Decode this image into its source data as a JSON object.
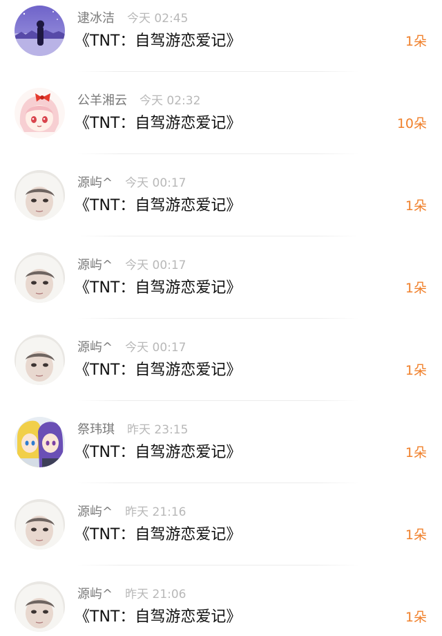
{
  "gift_list": {
    "items": [
      {
        "user_name": "逮冰洁",
        "time": "今天 02:45",
        "title": "《TNT：自驾游恋爱记》",
        "count": "1朵",
        "avatar_icon": "avatar-night-scene"
      },
      {
        "user_name": "公羊湘云",
        "time": "今天 02:32",
        "title": "《TNT：自驾游恋爱记》",
        "count": "10朵",
        "avatar_icon": "avatar-anime-girl-red-bow"
      },
      {
        "user_name": "源屿^",
        "time": "今天 00:17",
        "title": "《TNT：自驾游恋爱记》",
        "count": "1朵",
        "avatar_icon": "avatar-girl-white-hood"
      },
      {
        "user_name": "源屿^",
        "time": "今天 00:17",
        "title": "《TNT：自驾游恋爱记》",
        "count": "1朵",
        "avatar_icon": "avatar-girl-white-hood"
      },
      {
        "user_name": "源屿^",
        "time": "今天 00:17",
        "title": "《TNT：自驾游恋爱记》",
        "count": "1朵",
        "avatar_icon": "avatar-girl-white-hood"
      },
      {
        "user_name": "祭玮琪",
        "time": "昨天 23:15",
        "title": "《TNT：自驾游恋爱记》",
        "count": "1朵",
        "avatar_icon": "avatar-anime-duo"
      },
      {
        "user_name": "源屿^",
        "time": "昨天 21:16",
        "title": "《TNT：自驾游恋爱记》",
        "count": "1朵",
        "avatar_icon": "avatar-girl-white-hood"
      },
      {
        "user_name": "源屿^",
        "time": "昨天 21:06",
        "title": "《TNT：自驾游恋爱记》",
        "count": "1朵",
        "avatar_icon": "avatar-girl-white-hood"
      }
    ]
  },
  "colors": {
    "name": "#7a7a7a",
    "time": "#b8b8b8",
    "title": "#111111",
    "count_accent": "#f0802b",
    "divider": "#ececec"
  }
}
